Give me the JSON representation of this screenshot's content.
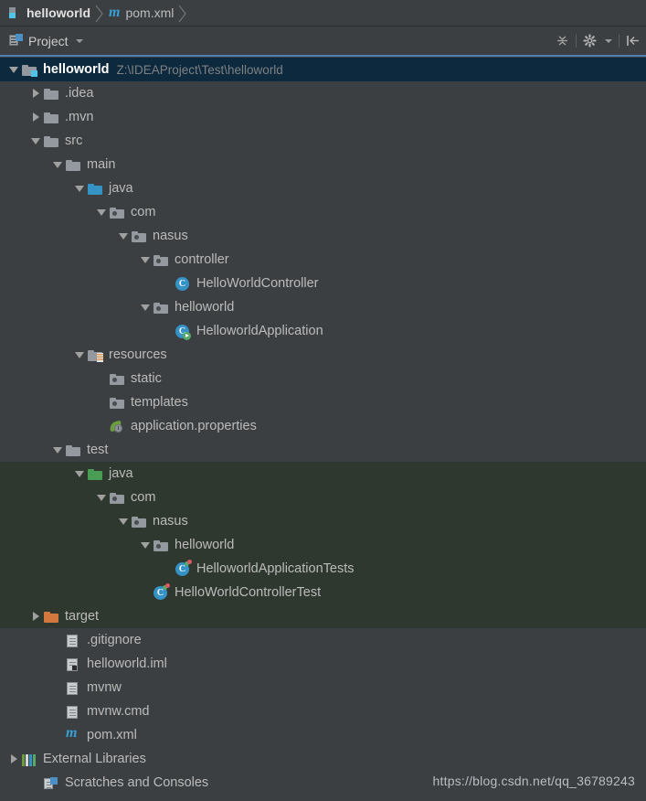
{
  "breadcrumb": {
    "items": [
      {
        "label": "helloworld",
        "icon": "module-icon",
        "bold": true
      },
      {
        "label": "pom.xml",
        "icon": "maven-icon",
        "bold": false
      }
    ]
  },
  "tool_window": {
    "title": "Project",
    "title_icon": "project-view-icon",
    "dropdown_icon": "chevron-down-icon",
    "buttons": [
      {
        "name": "collapse-all-icon",
        "label": "Collapse All"
      },
      {
        "name": "gear-icon",
        "label": "Settings"
      },
      {
        "name": "hide-icon",
        "label": "Hide"
      }
    ]
  },
  "tree": {
    "rows": [
      {
        "label": "helloworld",
        "path": "Z:\\IDEAProject\\Test\\helloworld",
        "indent": 0,
        "arrow": "down",
        "icon": "module-folder-icon",
        "style": "root",
        "selected": true
      },
      {
        "label": ".idea",
        "indent": 1,
        "arrow": "right",
        "icon": "folder-icon"
      },
      {
        "label": ".mvn",
        "indent": 1,
        "arrow": "right",
        "icon": "folder-icon"
      },
      {
        "label": "src",
        "indent": 1,
        "arrow": "down",
        "icon": "folder-icon"
      },
      {
        "label": "main",
        "indent": 2,
        "arrow": "down",
        "icon": "folder-icon"
      },
      {
        "label": "java",
        "indent": 3,
        "arrow": "down",
        "icon": "source-root-folder-icon"
      },
      {
        "label": "com",
        "indent": 4,
        "arrow": "down",
        "icon": "package-icon"
      },
      {
        "label": "nasus",
        "indent": 5,
        "arrow": "down",
        "icon": "package-icon"
      },
      {
        "label": "controller",
        "indent": 6,
        "arrow": "down",
        "icon": "package-icon"
      },
      {
        "label": "HelloWorldController",
        "indent": 7,
        "arrow": "none",
        "icon": "java-class-icon"
      },
      {
        "label": "helloworld",
        "indent": 6,
        "arrow": "down",
        "icon": "package-icon"
      },
      {
        "label": "HelloworldApplication",
        "indent": 7,
        "arrow": "none",
        "icon": "java-class-runnable-icon"
      },
      {
        "label": "resources",
        "indent": 3,
        "arrow": "down",
        "icon": "resources-root-folder-icon"
      },
      {
        "label": "static",
        "indent": 4,
        "arrow": "none",
        "icon": "package-icon"
      },
      {
        "label": "templates",
        "indent": 4,
        "arrow": "none",
        "icon": "package-icon"
      },
      {
        "label": "application.properties",
        "indent": 4,
        "arrow": "none",
        "icon": "spring-properties-icon"
      },
      {
        "label": "test",
        "indent": 2,
        "arrow": "down",
        "icon": "folder-icon"
      },
      {
        "label": "java",
        "indent": 3,
        "arrow": "down",
        "icon": "test-source-root-folder-icon",
        "band": true
      },
      {
        "label": "com",
        "indent": 4,
        "arrow": "down",
        "icon": "package-icon",
        "band": true
      },
      {
        "label": "nasus",
        "indent": 5,
        "arrow": "down",
        "icon": "package-icon",
        "band": true
      },
      {
        "label": "helloworld",
        "indent": 6,
        "arrow": "down",
        "icon": "package-icon",
        "band": true
      },
      {
        "label": "HelloworldApplicationTests",
        "indent": 7,
        "arrow": "none",
        "icon": "java-test-class-icon",
        "band": true
      },
      {
        "label": "HelloWorldControllerTest",
        "indent": 6,
        "arrow": "none",
        "icon": "java-test-class-icon",
        "band": true
      },
      {
        "label": "target",
        "indent": 1,
        "arrow": "right",
        "icon": "excluded-folder-icon",
        "band": true
      },
      {
        "label": ".gitignore",
        "indent": 2,
        "arrow": "none",
        "icon": "file-icon"
      },
      {
        "label": "helloworld.iml",
        "indent": 2,
        "arrow": "none",
        "icon": "iml-file-icon"
      },
      {
        "label": "mvnw",
        "indent": 2,
        "arrow": "none",
        "icon": "file-icon"
      },
      {
        "label": "mvnw.cmd",
        "indent": 2,
        "arrow": "none",
        "icon": "file-icon"
      },
      {
        "label": "pom.xml",
        "indent": 2,
        "arrow": "none",
        "icon": "maven-icon"
      },
      {
        "label": "External Libraries",
        "indent": 0,
        "arrow": "right",
        "icon": "libraries-icon"
      },
      {
        "label": "Scratches and Consoles",
        "indent": 1,
        "arrow": "none",
        "icon": "scratches-icon"
      }
    ]
  },
  "watermark": {
    "text": "https://blog.csdn.net/qq_36789243"
  },
  "colors": {
    "background": "#3C3F41",
    "selection": "#0D293E",
    "test_band": "#2F382F",
    "accent_blue": "#3592C4",
    "source_root": "#3592C4",
    "test_root": "#499C54",
    "excluded": "#D2773D",
    "text": "#BBBBBB",
    "path_text": "#7E8183"
  }
}
